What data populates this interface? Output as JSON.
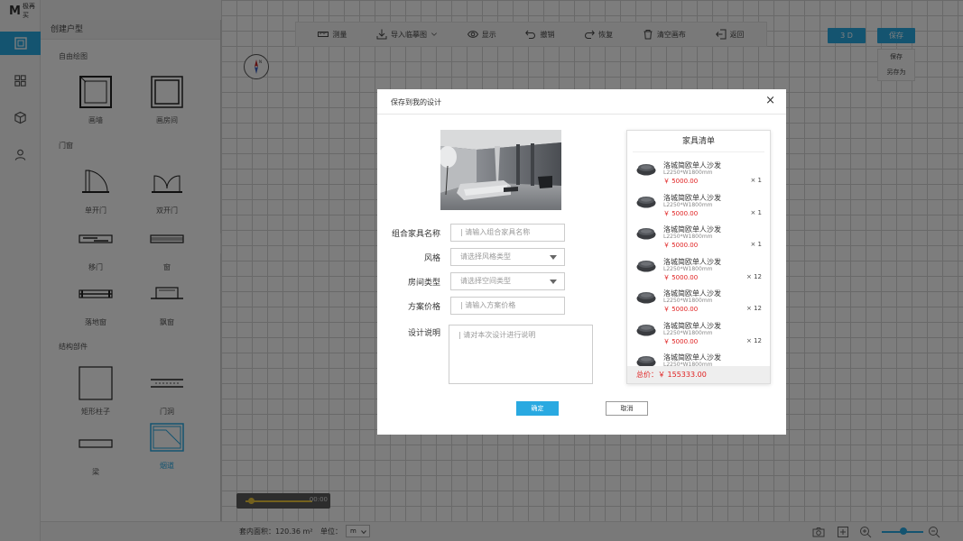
{
  "app": {
    "logo_mark": "M",
    "logo_text": "极再买"
  },
  "rail": {
    "items": [
      "draw-room-icon",
      "components-icon",
      "model-cube-icon",
      "user-icon"
    ]
  },
  "panel": {
    "title": "创建户型",
    "sections": {
      "free_draw": "自由绘图",
      "doors_windows": "门窗",
      "structure": "结构部件"
    },
    "tools": {
      "draw_wall": "画墙",
      "draw_room": "画房间",
      "single_door": "单开门",
      "double_door": "双开门",
      "sliding_door": "移门",
      "window": "窗",
      "floor_window": "落地窗",
      "bay_window": "飘窗",
      "rect_column": "矩形柱子",
      "doorway": "门洞",
      "beam": "梁",
      "flue": "烟道"
    }
  },
  "toolbar": {
    "measure": "测量",
    "import_trace": "导入临摹图",
    "display": "显示",
    "undo": "撤销",
    "redo": "恢复",
    "clear_canvas": "清空画布",
    "back": "返回"
  },
  "top_buttons": {
    "view3d": "3 D",
    "save": "保存"
  },
  "save_menu": {
    "save": "保存",
    "save_as": "另存为"
  },
  "timeline": {
    "time": "00:00"
  },
  "statusbar": {
    "area": "套内面积：120.36 m²",
    "unit_label": "单位：",
    "unit_value": "m"
  },
  "modal": {
    "title": "保存到我的设计",
    "close": "×",
    "fields": {
      "combo_name_label": "组合家具名称",
      "combo_name_placeholder": "| 请输入组合家具名称",
      "style_label": "风格",
      "style_placeholder": "请选择风格类型",
      "room_type_label": "房间类型",
      "room_type_placeholder": "请选择空间类型",
      "price_label": "方案价格",
      "price_placeholder": "| 请输入方案价格",
      "desc_label": "设计说明",
      "desc_placeholder": "| 请对本次设计进行说明"
    },
    "ok": "确定",
    "cancel": "取消",
    "list": {
      "title": "家具清单",
      "items": [
        {
          "name": "洛城简欧单人沙发",
          "dim": "L2250*W1800mm",
          "price": "￥ 5000.00",
          "qty": "× 1"
        },
        {
          "name": "洛城简欧单人沙发",
          "dim": "L2250*W1800mm",
          "price": "￥ 5000.00",
          "qty": "× 1"
        },
        {
          "name": "洛城简欧单人沙发",
          "dim": "L2250*W1800mm",
          "price": "￥ 5000.00",
          "qty": "× 1"
        },
        {
          "name": "洛城简欧单人沙发",
          "dim": "L2250*W1800mm",
          "price": "￥ 5000.00",
          "qty": "× 12"
        },
        {
          "name": "洛城简欧单人沙发",
          "dim": "L2250*W1800mm",
          "price": "￥ 5000.00",
          "qty": "× 12"
        },
        {
          "name": "洛城简欧单人沙发",
          "dim": "L2250*W1800mm",
          "price": "￥ 5000.00",
          "qty": "× 12"
        },
        {
          "name": "洛城简欧单人沙发",
          "dim": "L2250*W1800mm",
          "price": "",
          "qty": ""
        }
      ],
      "total": "总价：￥ 155333.00"
    }
  },
  "colors": {
    "accent": "#29a9e1",
    "price": "#e02020"
  }
}
